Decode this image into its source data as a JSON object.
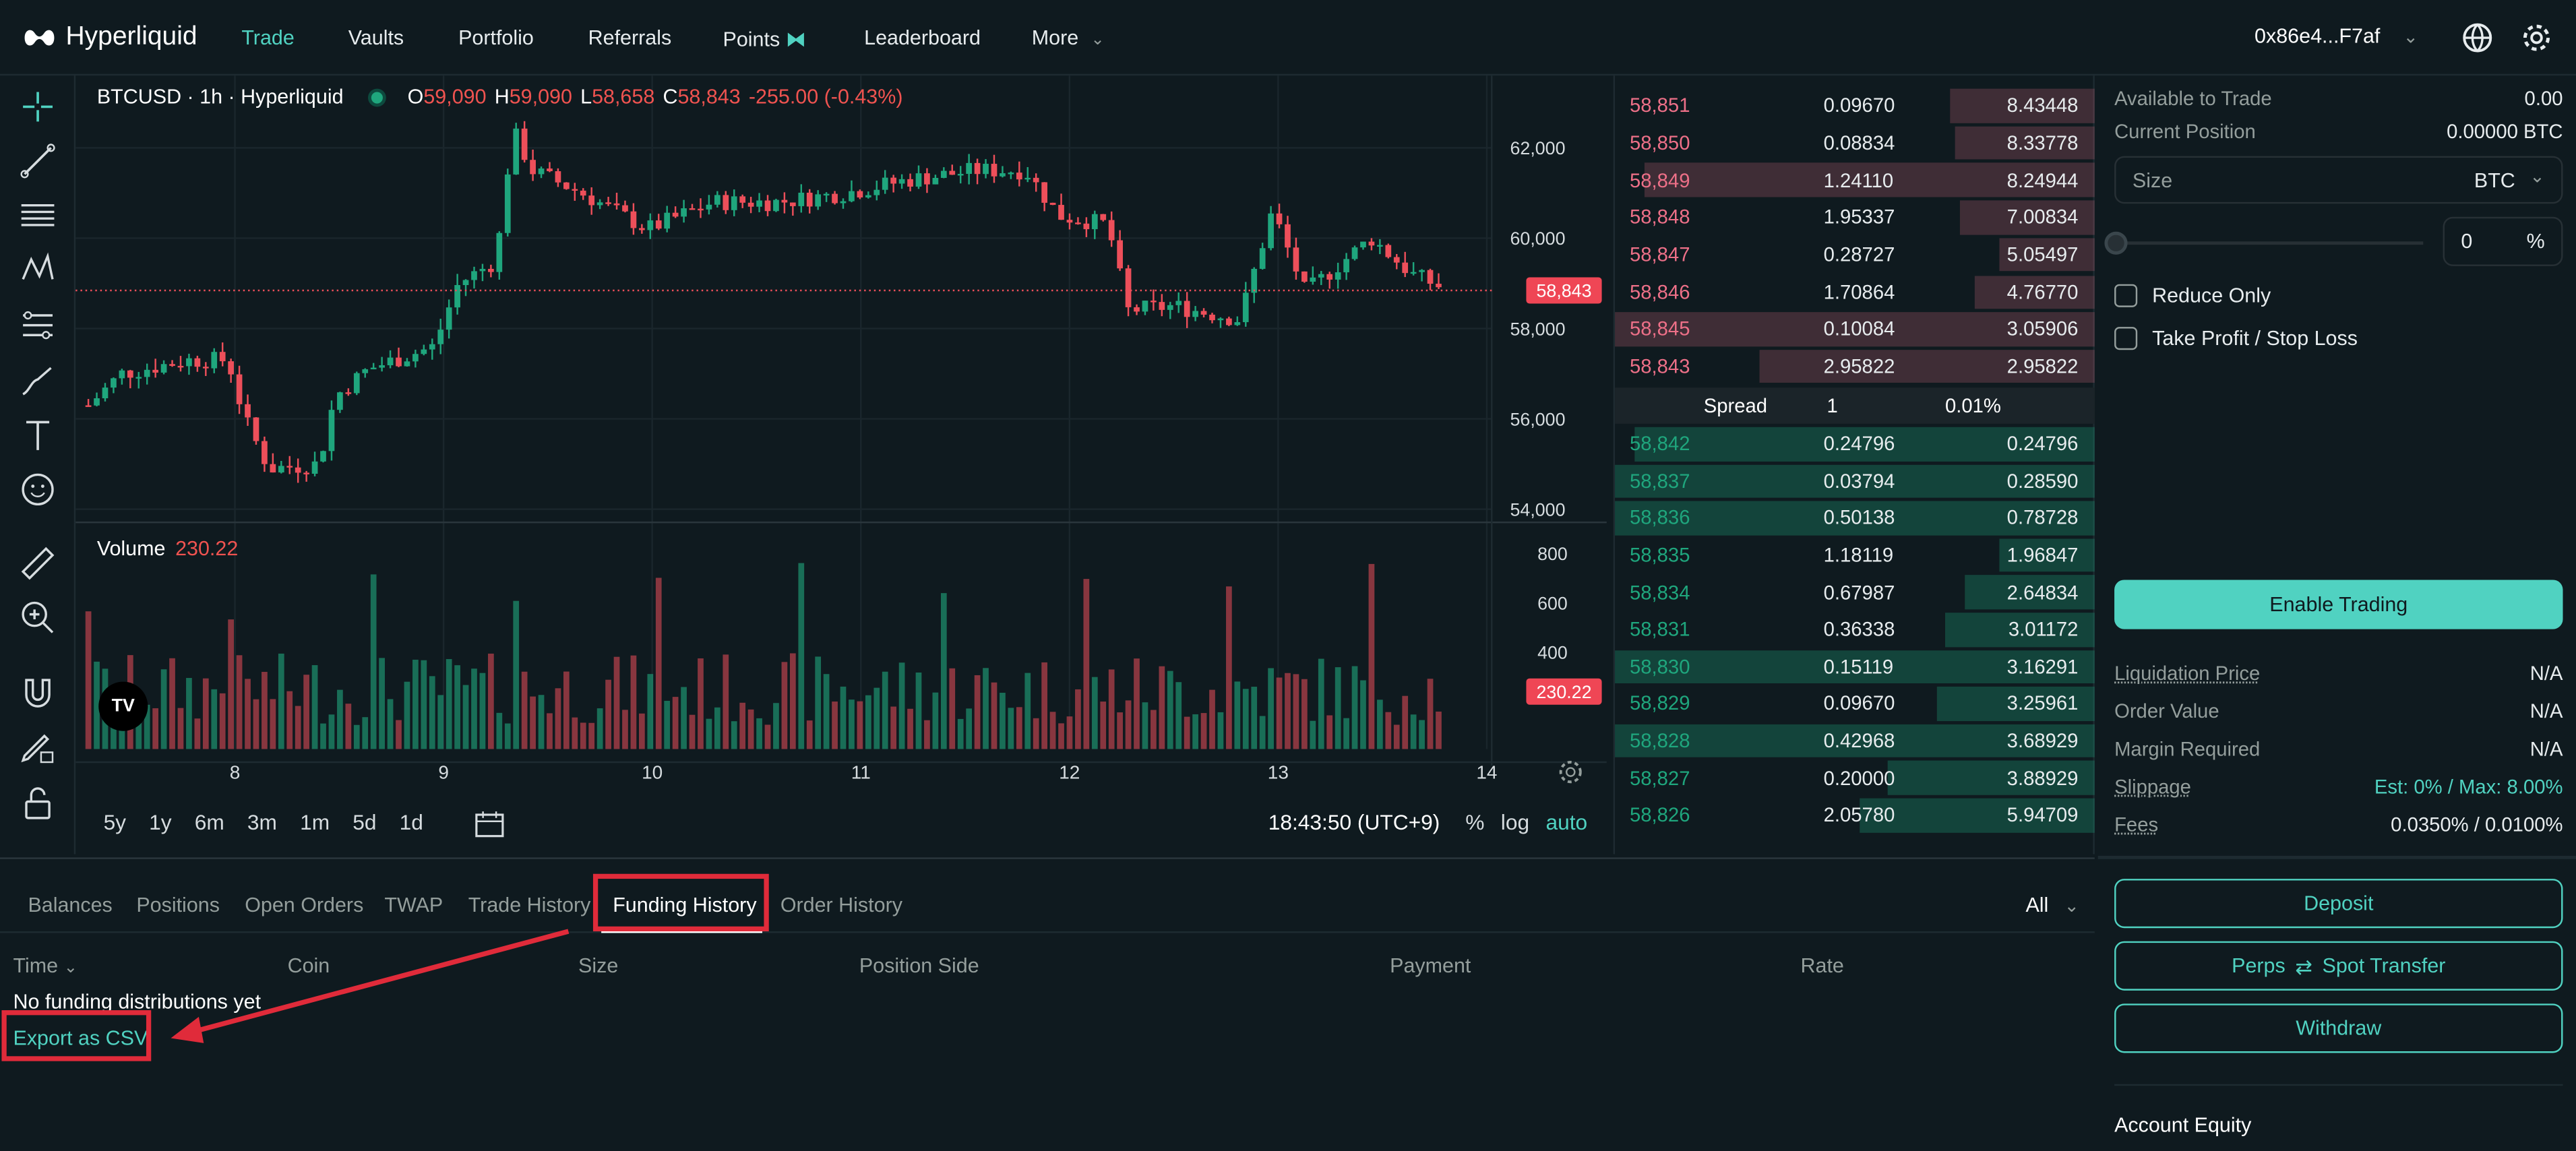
{
  "header": {
    "brand": "Hyperliquid",
    "nav": [
      "Trade",
      "Vaults",
      "Portfolio",
      "Referrals",
      "Points",
      "Leaderboard",
      "More"
    ],
    "account": "0x86e4...F7af"
  },
  "chart": {
    "symbol": "BTCUSD · 1h · Hyperliquid",
    "ohlc": {
      "o_label": "O",
      "o": "59,090",
      "h_label": "H",
      "h": "59,090",
      "l_label": "L",
      "l": "58,658",
      "c_label": "C",
      "c": "58,843",
      "change": "-255.00 (-0.43%)"
    },
    "price_axis": [
      "62,000",
      "60,000",
      "58,000",
      "56,000",
      "54,000"
    ],
    "last_price_tag": "58,843",
    "volume_label": "Volume",
    "volume_value": "230.22",
    "volume_axis": [
      "800",
      "600",
      "400"
    ],
    "volume_tag": "230.22",
    "x_axis": [
      "8",
      "9",
      "10",
      "11",
      "12",
      "13",
      "14"
    ],
    "timeframes": [
      "5y",
      "1y",
      "6m",
      "3m",
      "1m",
      "5d",
      "1d"
    ],
    "clock": "18:43:50 (UTC+9)",
    "options": [
      "%",
      "log",
      "auto"
    ]
  },
  "orderbook": {
    "asks": [
      {
        "price": "58,851",
        "size": "0.09670",
        "total": "8.43448",
        "depth": 0.3
      },
      {
        "price": "58,850",
        "size": "0.08834",
        "total": "8.33778",
        "depth": 0.29
      },
      {
        "price": "58,849",
        "size": "1.24110",
        "total": "8.24944",
        "depth": 0.94
      },
      {
        "price": "58,848",
        "size": "1.95337",
        "total": "7.00834",
        "depth": 0.28
      },
      {
        "price": "58,847",
        "size": "0.28727",
        "total": "5.05497",
        "depth": 0.2
      },
      {
        "price": "58,846",
        "size": "1.70864",
        "total": "4.76770",
        "depth": 0.25
      },
      {
        "price": "58,845",
        "size": "0.10084",
        "total": "3.05906",
        "depth": 1.0
      },
      {
        "price": "58,843",
        "size": "2.95822",
        "total": "2.95822",
        "depth": 0.7
      }
    ],
    "spread": {
      "label": "Spread",
      "value": "1",
      "pct": "0.01%"
    },
    "bids": [
      {
        "price": "58,842",
        "size": "0.24796",
        "total": "0.24796",
        "depth": 0.96
      },
      {
        "price": "58,837",
        "size": "0.03794",
        "total": "0.28590",
        "depth": 1.0
      },
      {
        "price": "58,836",
        "size": "0.50138",
        "total": "0.78728",
        "depth": 1.0
      },
      {
        "price": "58,835",
        "size": "1.18119",
        "total": "1.96847",
        "depth": 0.2
      },
      {
        "price": "58,834",
        "size": "0.67987",
        "total": "2.64834",
        "depth": 0.27
      },
      {
        "price": "58,831",
        "size": "0.36338",
        "total": "3.01172",
        "depth": 0.31
      },
      {
        "price": "58,830",
        "size": "0.15119",
        "total": "3.16291",
        "depth": 1.0
      },
      {
        "price": "58,829",
        "size": "0.09670",
        "total": "3.25961",
        "depth": 0.33
      },
      {
        "price": "58,828",
        "size": "0.42968",
        "total": "3.68929",
        "depth": 1.0
      },
      {
        "price": "58,827",
        "size": "0.20000",
        "total": "3.88929",
        "depth": 0.43
      },
      {
        "price": "58,826",
        "size": "2.05780",
        "total": "5.94709",
        "depth": 0.49
      }
    ]
  },
  "trade_panel": {
    "available_label": "Available to Trade",
    "available": "0.00",
    "position_label": "Current Position",
    "position": "0.00000 BTC",
    "size_placeholder": "Size",
    "size_unit": "BTC",
    "leverage_value": "0",
    "leverage_unit": "%",
    "reduce_only": "Reduce Only",
    "tp_sl": "Take Profit / Stop Loss",
    "enable_trading": "Enable Trading",
    "liq_label": "Liquidation Price",
    "liq": "N/A",
    "order_value_label": "Order Value",
    "order_value": "N/A",
    "margin_label": "Margin Required",
    "margin": "N/A",
    "slippage_label": "Slippage",
    "slippage": "Est: 0% / Max: 8.00%",
    "fees_label": "Fees",
    "fees": "0.0350% / 0.0100%",
    "deposit": "Deposit",
    "transfer_left": "Perps",
    "transfer_right": "Spot Transfer",
    "withdraw": "Withdraw",
    "equity": "Account Equity"
  },
  "bottom": {
    "tabs": [
      "Balances",
      "Positions",
      "Open Orders",
      "TWAP",
      "Trade History",
      "Funding History",
      "Order History"
    ],
    "filter": "All",
    "columns": [
      "Time",
      "Coin",
      "Size",
      "Position Side",
      "Payment",
      "Rate"
    ],
    "empty": "No funding distributions yet",
    "export": "Export as CSV"
  },
  "colors": {
    "accent": "#50d2c1",
    "up": "#1fa67d",
    "down": "#ed7088",
    "annotation": "#e02b3a"
  }
}
